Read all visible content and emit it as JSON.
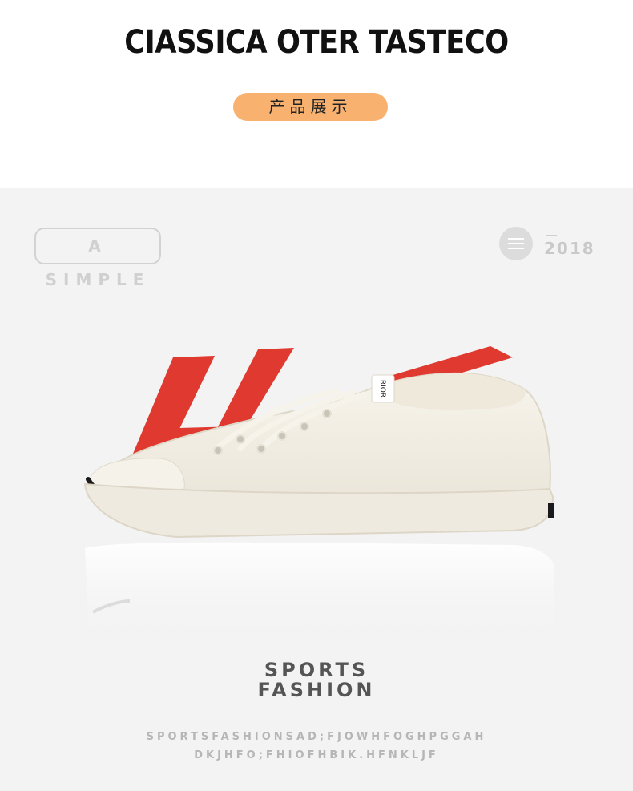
{
  "header": {
    "title": "CIASSICA OTER TASTECO",
    "tag_label": "产品展示"
  },
  "showcase": {
    "badge": "A SIMPLE",
    "menu_icon": "menu-icon",
    "year": "2018",
    "shoe_brand_tab": "RIOR",
    "sports_line1": "SPORTS",
    "sports_line2": "FASHION",
    "filler_line1": "SPORTSFASHIONSAD;FJOWHFOGHPGGAH",
    "filler_line2": "DKJHFO;FHIOFHBIK.HFNKLJF"
  },
  "colors": {
    "accent_pill": "#f8b16f",
    "graphic_red": "#e03a30",
    "showcase_bg": "#f3f3f3"
  }
}
